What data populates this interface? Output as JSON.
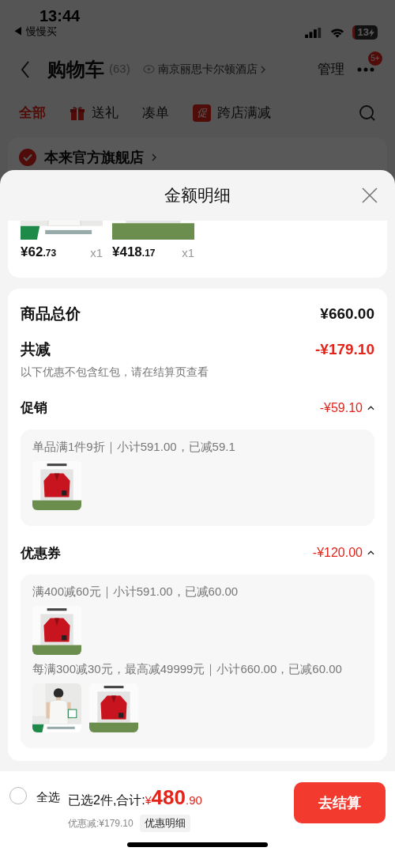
{
  "status_bar": {
    "time": "13:44",
    "back_app": "◀ 慢慢买",
    "battery": "13"
  },
  "nav": {
    "title": "购物车",
    "count": "(63)",
    "location": "南京丽思卡尔顿酒店",
    "manage": "管理",
    "badge": "5+"
  },
  "tabs": [
    {
      "label": "全部",
      "selected": true,
      "kind": "plain"
    },
    {
      "label": "送礼",
      "selected": false,
      "kind": "gift"
    },
    {
      "label": "凑单",
      "selected": false,
      "kind": "plain"
    },
    {
      "label": "跨店满减",
      "selected": false,
      "kind": "promo",
      "badge": "促"
    }
  ],
  "store": {
    "name": "本来官方旗舰店",
    "checked": true
  },
  "sheet": {
    "title": "金额明细"
  },
  "top_items": [
    {
      "price": "¥62",
      "cents": ".73",
      "qty": "x1"
    },
    {
      "price": "¥418",
      "cents": ".17",
      "qty": "x1"
    }
  ],
  "summary": {
    "total_label": "商品总价",
    "total": "¥660.00",
    "discount_label": "共减",
    "discount": "-¥179.10",
    "note": "以下优惠不包含红包，请在结算页查看"
  },
  "sections": [
    {
      "title": "促销",
      "amount": "-¥59.10",
      "expanded": true,
      "rules": [
        {
          "text": "单品满1件9折｜小计591.00，已减59.1"
        }
      ]
    },
    {
      "title": "优惠券",
      "amount": "-¥120.00",
      "expanded": true,
      "rules": [
        {
          "text": "满400减60元｜小计591.00，已减60.00"
        },
        {
          "text": "每满300减30元，最高减49999元｜小计660.00，已减60.00"
        }
      ]
    }
  ],
  "bottom": {
    "select_all": "全选",
    "checked": false,
    "selected_text": "已选2件,合计:",
    "currency": "¥",
    "amount": "480",
    "cents": ".90",
    "saving": "优惠减:¥179.10",
    "detail_button": "优惠明细",
    "checkout": "去结算"
  }
}
